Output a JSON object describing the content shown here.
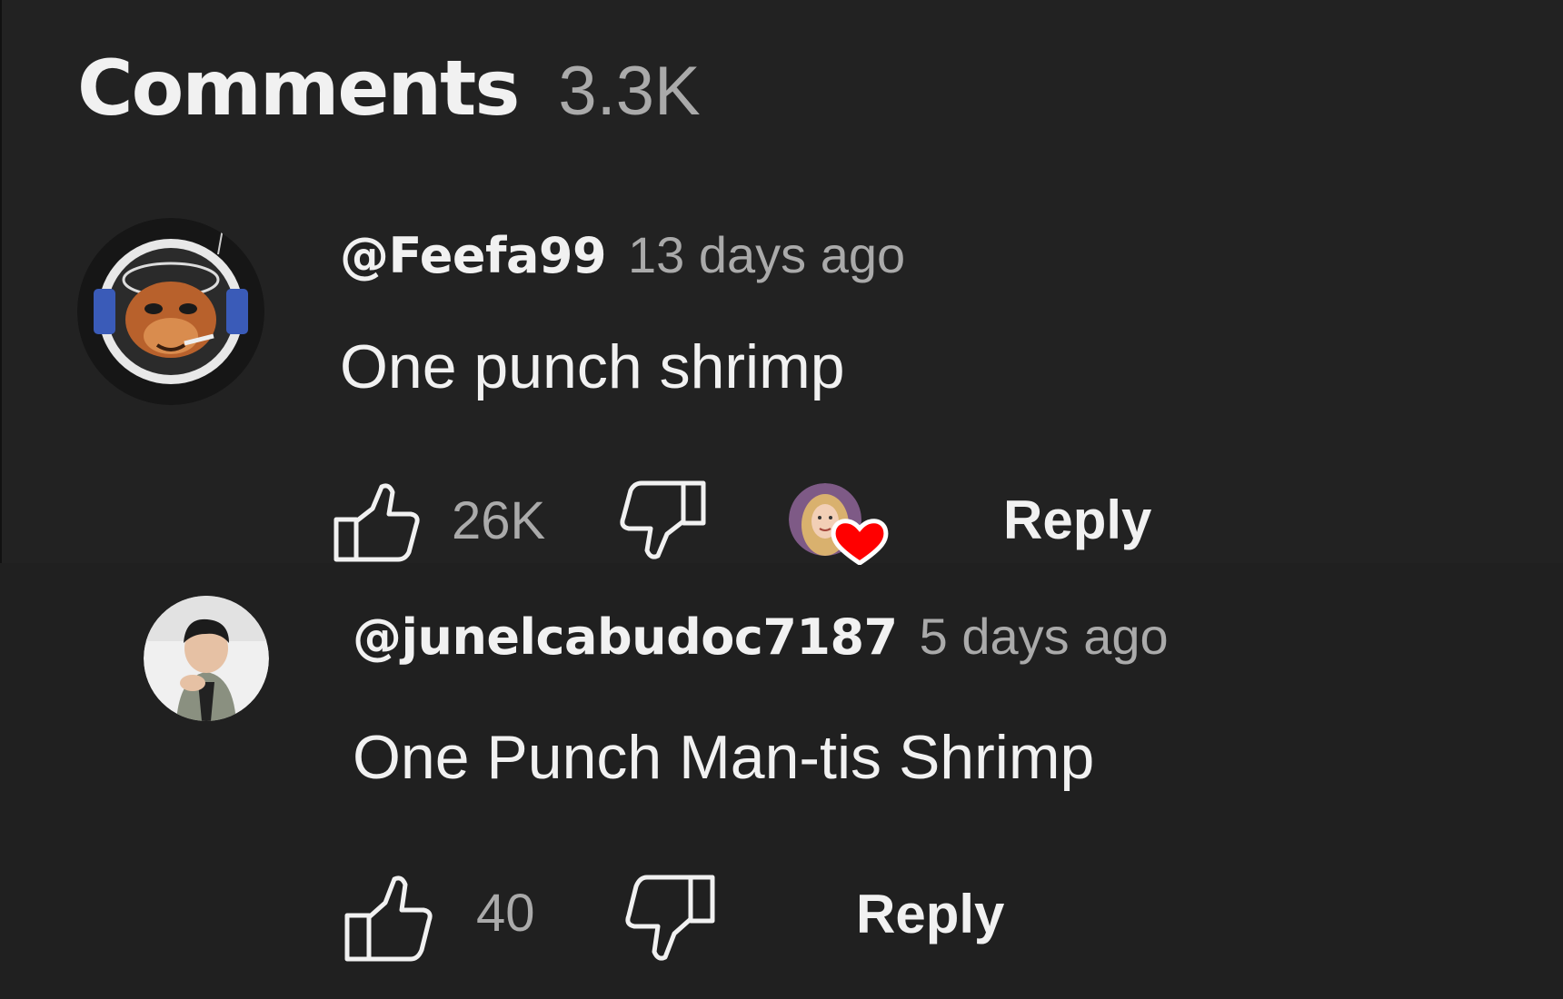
{
  "header": {
    "title": "Comments",
    "count": "3.3K"
  },
  "comments": [
    {
      "author": "@Feefa99",
      "time": "13 days ago",
      "text": "One punch shrimp",
      "likes": "26K",
      "reply_label": "Reply",
      "avatar_icon": "astronaut-monkey-avatar",
      "creator_heart": true
    },
    {
      "author": "@junelcabudoc7187",
      "time": "5 days ago",
      "text": "One Punch Man-tis Shrimp",
      "likes": "40",
      "reply_label": "Reply",
      "avatar_icon": "person-photo-avatar"
    }
  ],
  "colors": {
    "background": "#1f1f1f",
    "primary_text": "#f1f1f1",
    "secondary_text": "#aaaaaa",
    "heart": "#ff0000"
  }
}
